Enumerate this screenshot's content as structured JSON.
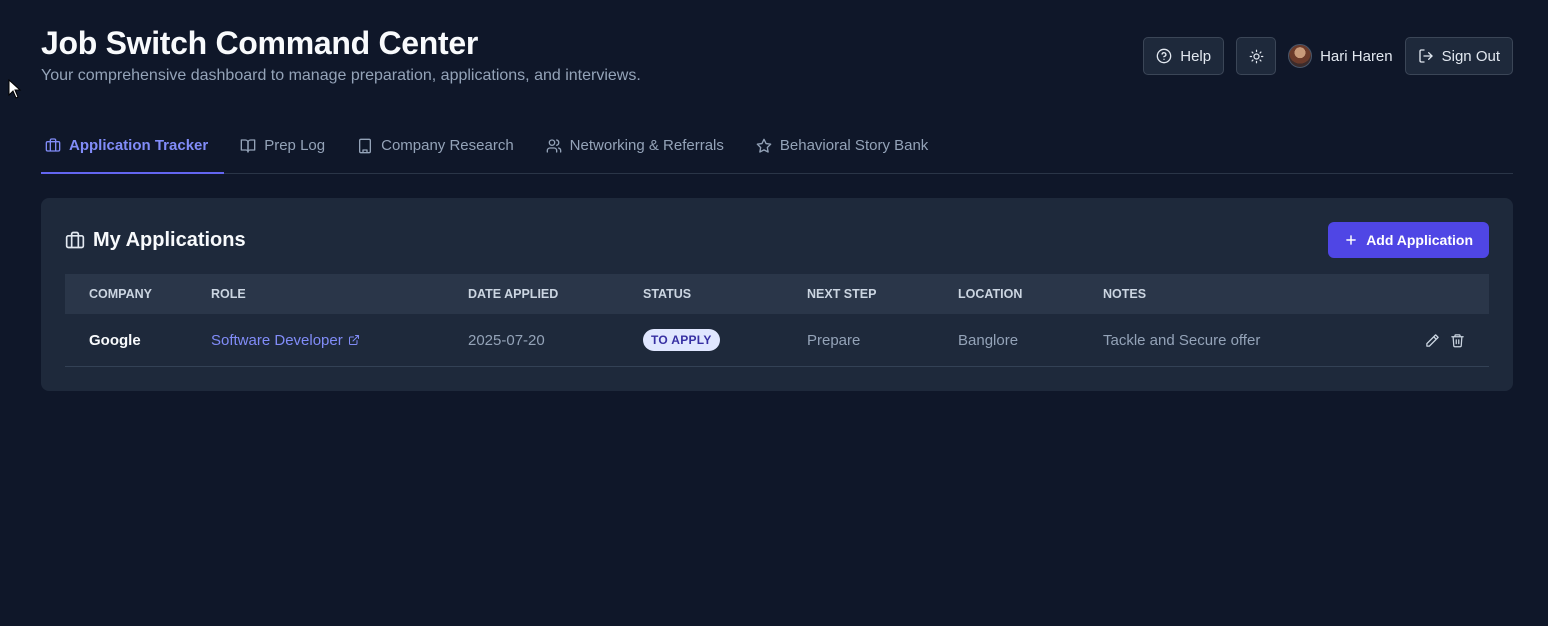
{
  "header": {
    "title": "Job Switch Command Center",
    "subtitle": "Your comprehensive dashboard to manage preparation, applications, and interviews.",
    "help_label": "Help",
    "user_name": "Hari Haren",
    "signout_label": "Sign Out"
  },
  "tabs": [
    {
      "label": "Application Tracker",
      "icon": "briefcase-icon",
      "active": true
    },
    {
      "label": "Prep Log",
      "icon": "book-icon",
      "active": false
    },
    {
      "label": "Company Research",
      "icon": "building-icon",
      "active": false
    },
    {
      "label": "Networking & Referrals",
      "icon": "users-icon",
      "active": false
    },
    {
      "label": "Behavioral Story Bank",
      "icon": "star-icon",
      "active": false
    }
  ],
  "applications": {
    "title": "My Applications",
    "add_label": "Add Application",
    "columns": [
      "Company",
      "Role",
      "Date Applied",
      "Status",
      "Next Step",
      "Location",
      "Notes"
    ],
    "rows": [
      {
        "company": "Google",
        "role": "Software Developer",
        "date_applied": "2025-07-20",
        "status": "TO APPLY",
        "next_step": "Prepare",
        "location": "Banglore",
        "notes": "Tackle and Secure offer"
      }
    ]
  },
  "colors": {
    "background": "#0f1729",
    "card": "#1e293b",
    "accent": "#6366f1",
    "primary_button": "#4f46e5"
  }
}
